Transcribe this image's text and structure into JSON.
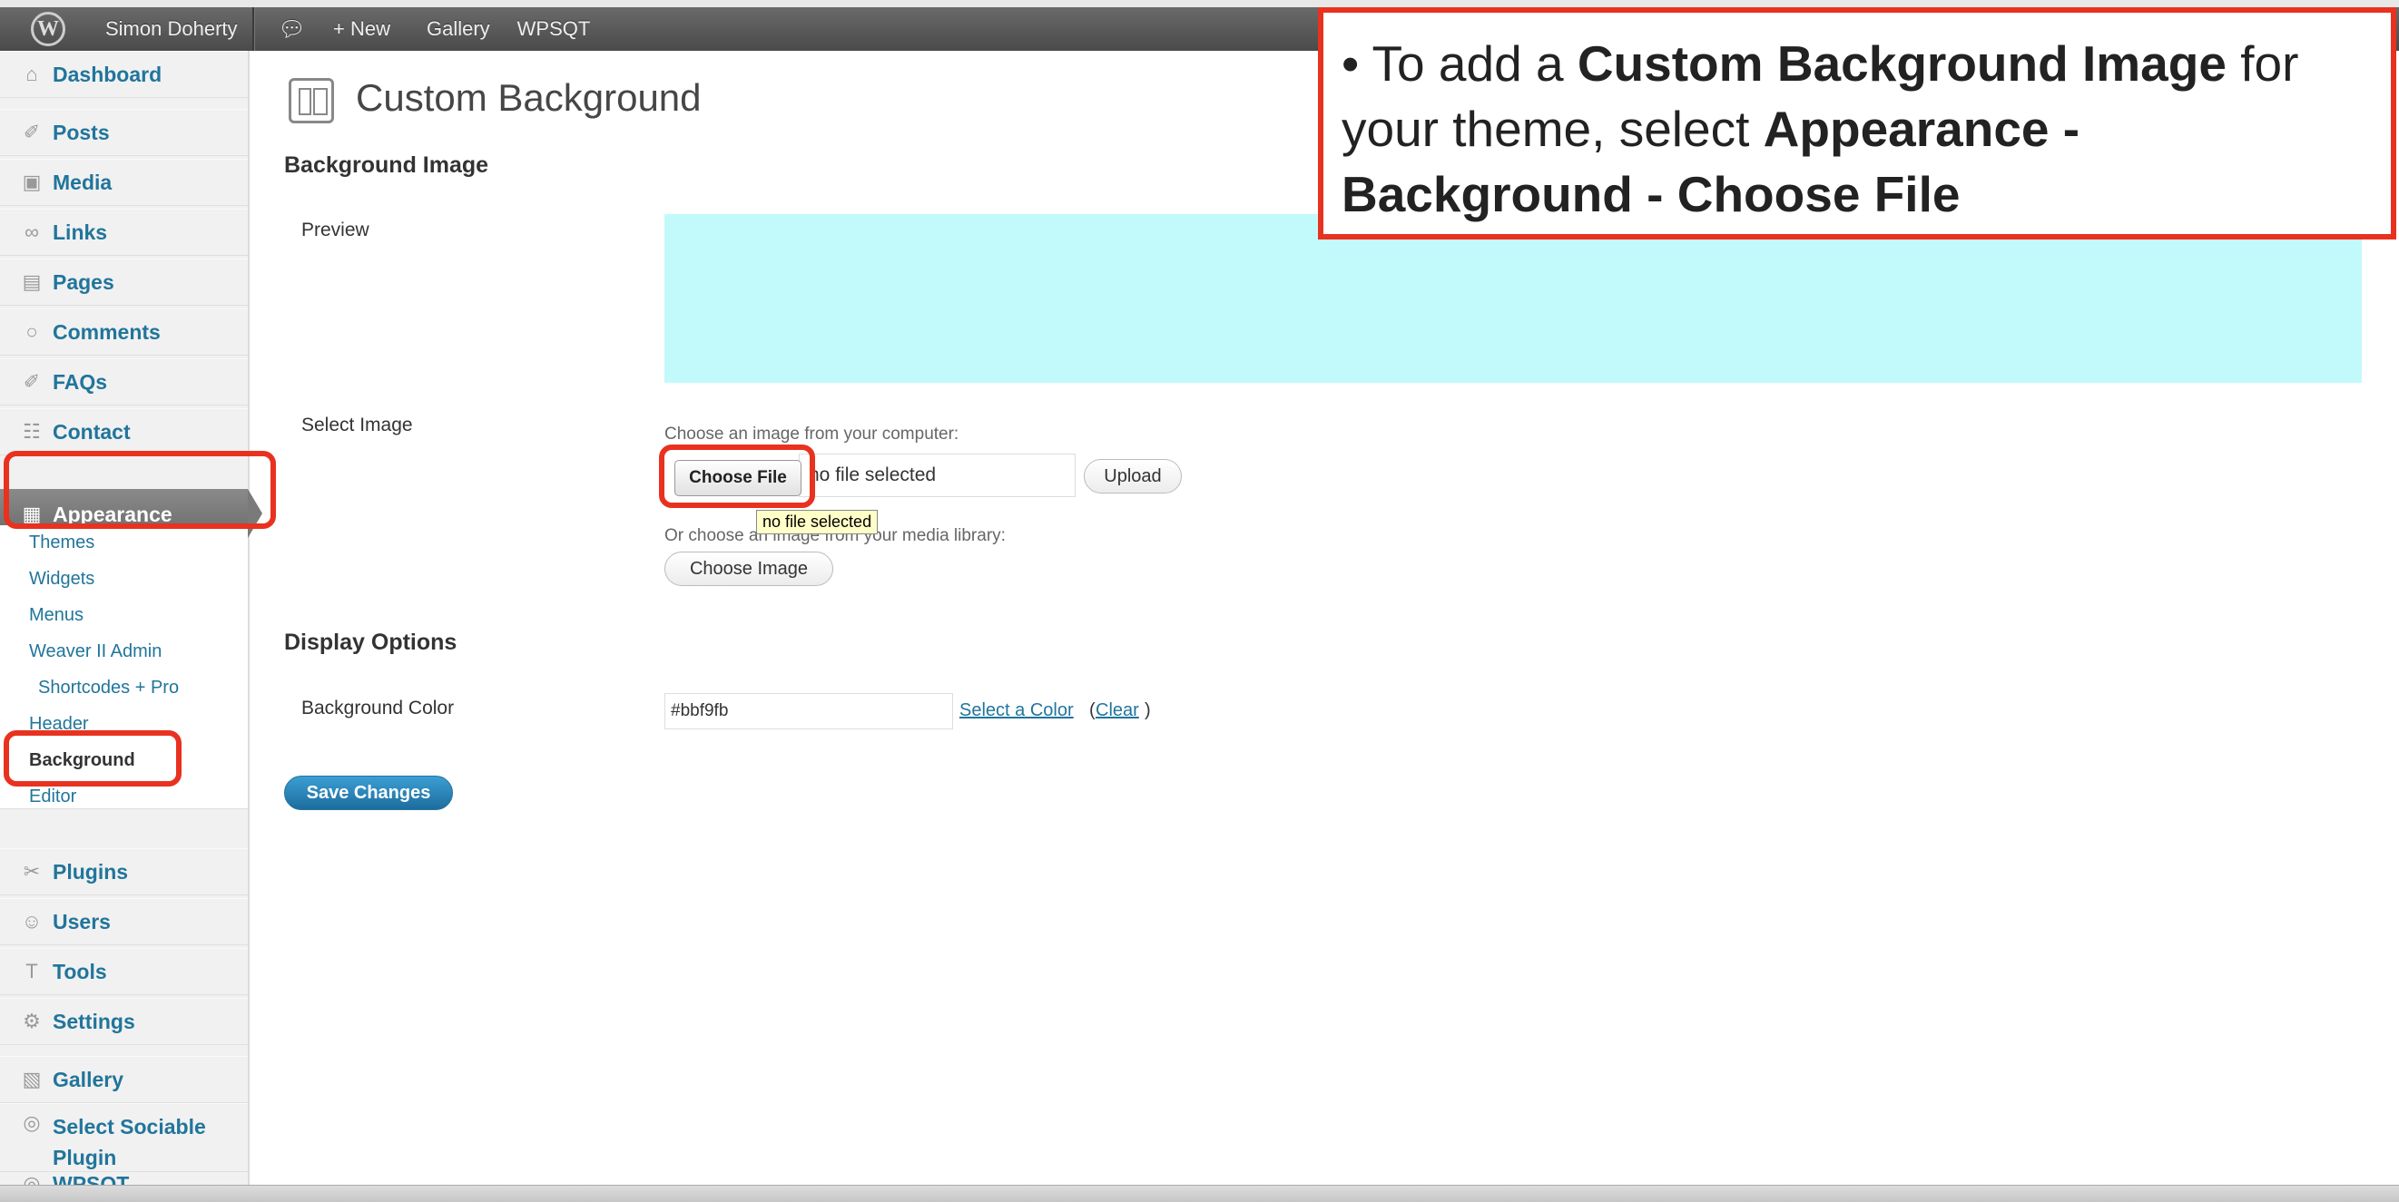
{
  "adminbar": {
    "logo": "W",
    "user": "Simon Doherty",
    "comment_icon": "comment-icon",
    "new_label": "+ New",
    "gallery": "Gallery",
    "wpsqt": "WPSQT"
  },
  "sidebar": {
    "items": [
      {
        "label": "Dashboard",
        "icon": "home-icon"
      },
      {
        "label": "Posts",
        "icon": "pin-icon"
      },
      {
        "label": "Media",
        "icon": "media-icon"
      },
      {
        "label": "Links",
        "icon": "link-icon"
      },
      {
        "label": "Pages",
        "icon": "pages-icon"
      },
      {
        "label": "Comments",
        "icon": "comment-icon"
      },
      {
        "label": "FAQs",
        "icon": "pin-icon"
      },
      {
        "label": "Contact",
        "icon": "contact-icon"
      },
      {
        "label": "Appearance",
        "icon": "appearance-icon"
      },
      {
        "label": "Plugins",
        "icon": "plugin-icon"
      },
      {
        "label": "Users",
        "icon": "users-icon"
      },
      {
        "label": "Tools",
        "icon": "tools-icon"
      },
      {
        "label": "Settings",
        "icon": "settings-icon"
      },
      {
        "label": "Gallery",
        "icon": "gallery-icon"
      },
      {
        "label": "Select Sociable",
        "icon": "sociable-icon"
      },
      {
        "label": "Plugin",
        "icon": ""
      },
      {
        "label": "WPSQT",
        "icon": "wpsqt-icon"
      }
    ],
    "submenu": [
      "Themes",
      "Widgets",
      "Menus",
      "Weaver II Admin",
      "Shortcodes + Pro",
      "Header",
      "Background",
      "Editor"
    ]
  },
  "main": {
    "title": "Custom Background",
    "background_image_heading": "Background Image",
    "preview_label": "Preview",
    "preview_color": "#bbf9fb",
    "select_image_label": "Select Image",
    "choose_hint": "Choose an image from your computer:",
    "choose_file": "Choose File",
    "no_file": "no file selected",
    "tooltip": "no file selected",
    "upload": "Upload",
    "media_hint": "Or choose an image from your media library:",
    "choose_image": "Choose Image",
    "display_options_heading": "Display Options",
    "bg_color_label": "Background Color",
    "bg_color_value": "#bbf9fb",
    "select_color": "Select a Color",
    "clear": "Clear",
    "clear_open": "(",
    "clear_close": ")",
    "save": "Save Changes"
  },
  "callout": {
    "bullet": "• To add a ",
    "b1": "Custom Background Image",
    "t2": " for your theme, select ",
    "b2": "Appearance - Background - Choose File"
  }
}
